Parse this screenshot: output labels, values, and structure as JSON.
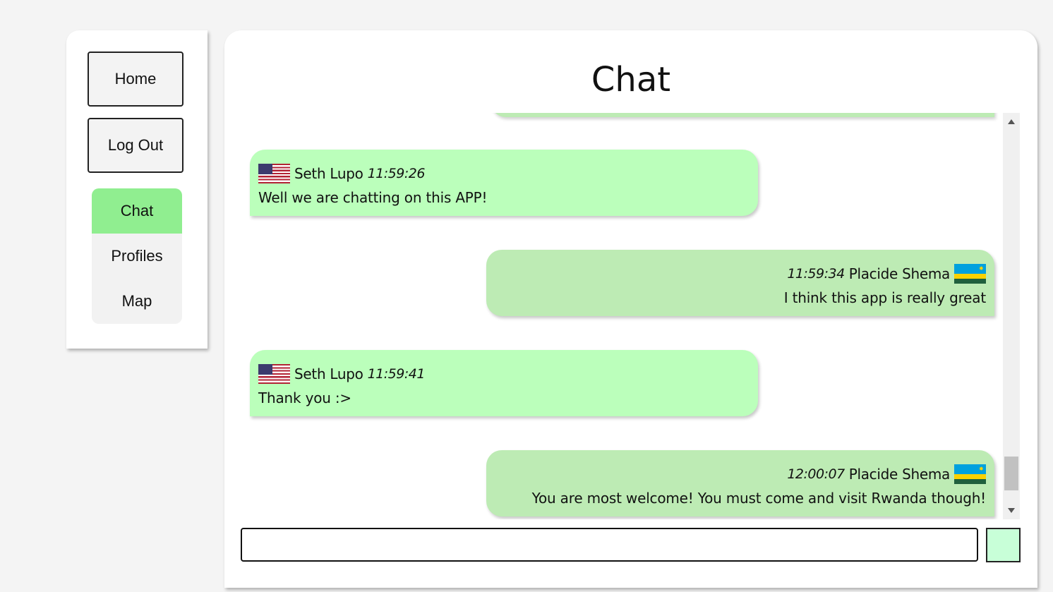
{
  "sidebar": {
    "home_label": "Home",
    "logout_label": "Log Out",
    "nav": [
      {
        "label": "Chat",
        "active": true
      },
      {
        "label": "Profiles",
        "active": false
      },
      {
        "label": "Map",
        "active": false
      }
    ],
    "active_color": "#90ee90"
  },
  "main": {
    "title": "Chat"
  },
  "messages": [
    {
      "side": "left",
      "flag": "us-flag-icon",
      "name": "Seth Lupo",
      "time": "11:59:26",
      "text": "Well we are chatting on this APP!"
    },
    {
      "side": "right",
      "flag": "rwanda-flag-icon",
      "name": "Placide Shema",
      "time": "11:59:34",
      "text": "I think this app is really great"
    },
    {
      "side": "left",
      "flag": "us-flag-icon",
      "name": "Seth Lupo",
      "time": "11:59:41",
      "text": "Thank you :>"
    },
    {
      "side": "right",
      "flag": "rwanda-flag-icon",
      "name": "Placide Shema",
      "time": "12:00:07",
      "text": "You are most welcome! You must come and visit Rwanda though!"
    }
  ],
  "colors": {
    "incoming_bubble": "#bbffbb",
    "outgoing_bubble": "#bdebb4",
    "send_button": "#c8ffd8"
  },
  "composer": {
    "value": "",
    "placeholder": ""
  }
}
